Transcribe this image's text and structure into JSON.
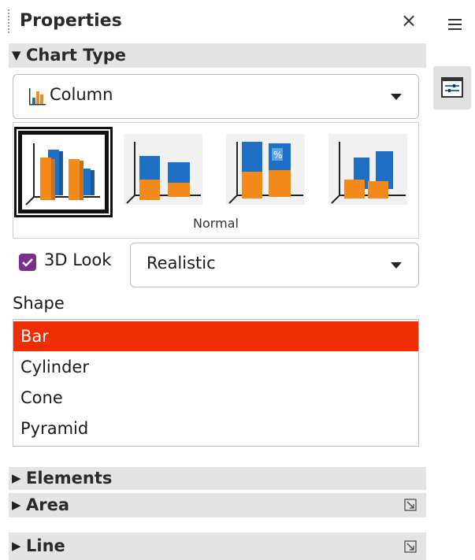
{
  "panel": {
    "title": "Properties",
    "close_glyph": "×"
  },
  "chart_type": {
    "section_title": "Chart Type",
    "dropdown_value": "Column",
    "variant_caption": "Normal",
    "variants": [
      "Normal",
      "Stacked",
      "Percent Stacked",
      "Deep"
    ],
    "selected_variant_index": 0
  },
  "look3d": {
    "checkbox_label": "3D Look",
    "checked": true,
    "scheme_value": "Realistic"
  },
  "shape": {
    "label": "Shape",
    "options": [
      "Bar",
      "Cylinder",
      "Cone",
      "Pyramid"
    ],
    "selected_index": 0
  },
  "sections": {
    "elements": "Elements",
    "area": "Area",
    "line": "Line"
  },
  "colors": {
    "accent_selected": "#ee2e00",
    "checkbox": "#7c2e8c",
    "bar_blue": "#1f6fc5",
    "bar_orange": "#f28a1c"
  },
  "icons": {
    "menu": "hamburger-icon",
    "properties_deck": "properties-deck-icon",
    "more_options": "more-options-icon",
    "expand": "triangle-right-icon",
    "collapse": "triangle-down-icon",
    "dropdown": "chevron-down-icon"
  }
}
